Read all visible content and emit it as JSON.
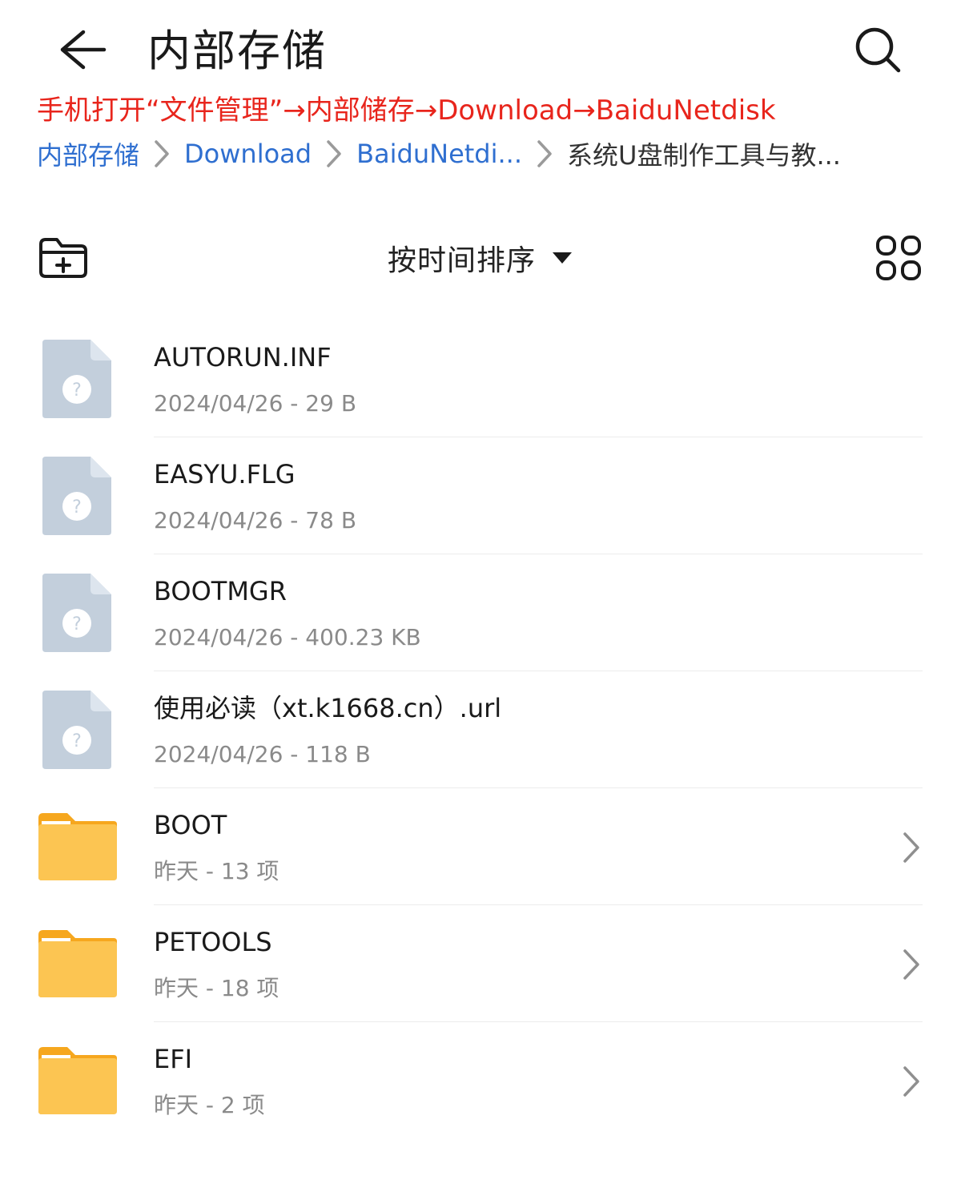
{
  "header": {
    "title": "内部存储",
    "back_icon": "arrow-left-icon",
    "search_icon": "search-icon"
  },
  "annotation": {
    "text": "手机打开“文件管理”→内部储存→Download→BaiduNetdisk",
    "color": "#e8251c"
  },
  "breadcrumb": {
    "items": [
      "内部存储",
      "Download",
      "BaiduNetdi...",
      "系统U盘制作工具与教..."
    ]
  },
  "toolbar": {
    "new_folder_icon": "new-folder-icon",
    "sort_label": "按时间排序",
    "sort_caret_icon": "caret-down-icon",
    "grid_view_icon": "grid-view-icon"
  },
  "files": [
    {
      "name": "AUTORUN.INF",
      "meta": "2024/04/26 - 29 B",
      "type": "file"
    },
    {
      "name": "EASYU.FLG",
      "meta": "2024/04/26 - 78 B",
      "type": "file"
    },
    {
      "name": "BOOTMGR",
      "meta": "2024/04/26 - 400.23 KB",
      "type": "file"
    },
    {
      "name": "使用必读（xt.k1668.cn）.url",
      "meta": "2024/04/26 - 118 B",
      "type": "file"
    },
    {
      "name": "BOOT",
      "meta": "昨天 - 13 项",
      "type": "folder"
    },
    {
      "name": "PETOOLS",
      "meta": "昨天 - 18 项",
      "type": "folder"
    },
    {
      "name": "EFI",
      "meta": "昨天 - 2 项",
      "type": "folder"
    }
  ],
  "colors": {
    "accent": "#2f6fd0",
    "folder": "#fcc552",
    "unknown_file": "#c3cfdc"
  }
}
